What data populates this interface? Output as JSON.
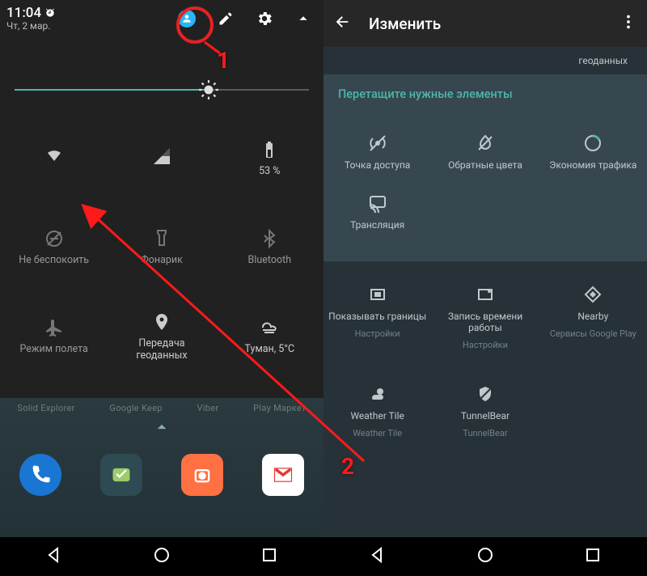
{
  "annotations": {
    "marker1": "1",
    "marker2": "2"
  },
  "left": {
    "time": "11:04",
    "date": "Чт, 2 мар.",
    "brightness_percent": 66,
    "tiles": {
      "wifi": "",
      "signal": "",
      "battery": "53 %",
      "dnd": "Не беспокоить",
      "flashlight": "Фонарик",
      "bluetooth": "Bluetooth",
      "airplane": "Режим полета",
      "location": "Передача геоданных",
      "weather": "Туман, 5°C"
    },
    "fade_apps": [
      "Solid Explorer",
      "Google Keep",
      "Viber",
      "Play Маркет"
    ]
  },
  "right": {
    "title": "Изменить",
    "topline": "геоданных",
    "section_header": "Перетащите нужные элементы",
    "row1": {
      "hotspot": "Точка доступа",
      "invert": "Обратные цвета",
      "datasaver": "Экономия трафика"
    },
    "row2": {
      "cast": "Трансляция"
    },
    "row3": {
      "layout": {
        "label": "Показывать границы",
        "sub": "Настройки"
      },
      "timerec": {
        "label": "Запись времени работы",
        "sub": "Настройки"
      },
      "nearby": {
        "label": "Nearby",
        "sub": "Сервисы Google Play"
      }
    },
    "row4": {
      "weather": {
        "label": "Weather Tile",
        "sub": "Weather Tile"
      },
      "tunnel": {
        "label": "TunnelBear",
        "sub": "TunnelBear"
      }
    }
  }
}
